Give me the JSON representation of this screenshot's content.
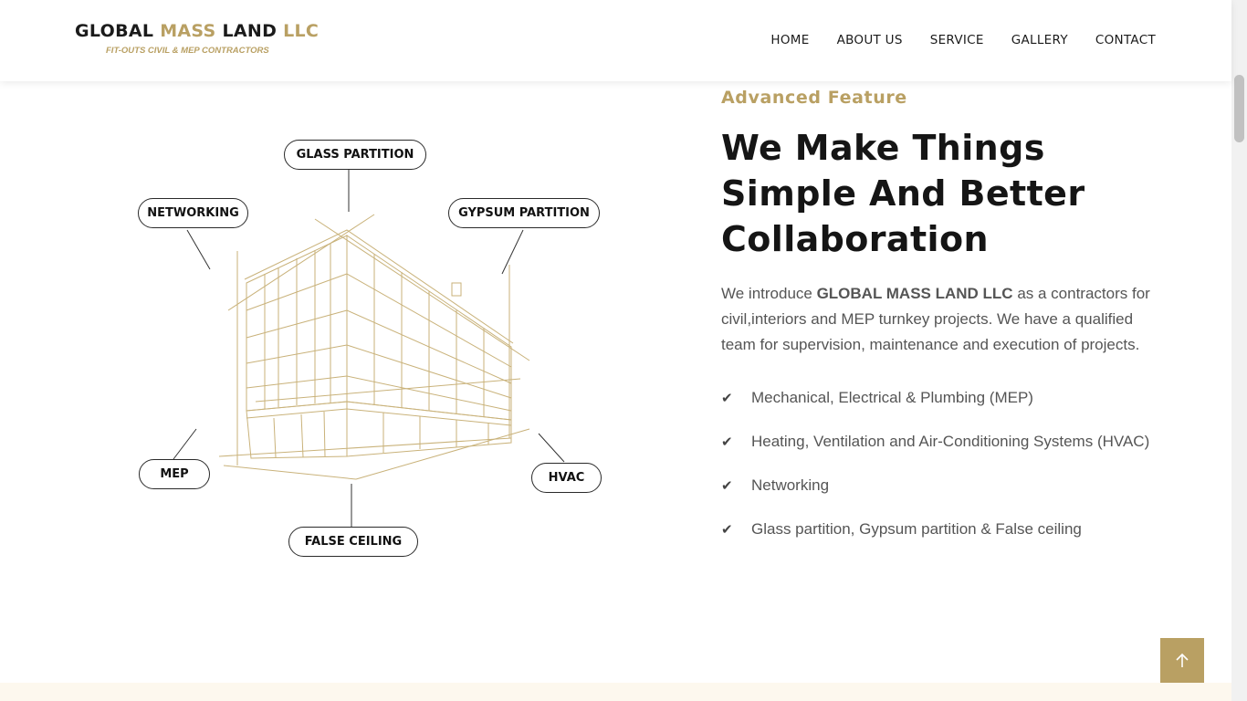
{
  "brand": {
    "name_part1": "GLOBAL",
    "name_part2": "MASS",
    "name_part3": "LAND",
    "name_part4": "LLC",
    "tagline": "FIT-OUTS CIVIL & MEP CONTRACTORS"
  },
  "nav": {
    "items": [
      "HOME",
      "ABOUT US",
      "SERVICE",
      "GALLERY",
      "CONTACT"
    ]
  },
  "illustration": {
    "labels": {
      "glass_partition": "GLASS PARTITION",
      "networking": "NETWORKING",
      "gypsum_partition": "GYPSUM PARTITION",
      "mep": "MEP",
      "hvac": "HVAC",
      "false_ceiling": "FALSE CEILING"
    },
    "line_color": "#c9b27a"
  },
  "content": {
    "eyebrow": "Advanced Feature",
    "heading": "We Make Things Simple And Better Collaboration",
    "intro_before": "We introduce ",
    "intro_bold": "GLOBAL MASS LAND LLC",
    "intro_after": " as a contractors for civil,interiors and MEP turnkey projects. We have a qualified team for supervision, maintenance and execution of projects.",
    "features": [
      "Mechanical, Electrical & Plumbing (MEP)",
      "Heating, Ventilation and Air-Conditioning Systems (HVAC)",
      "Networking",
      "Glass partition, Gypsum partition & False ceiling"
    ],
    "check_icon": "check-icon"
  },
  "colors": {
    "accent": "#b9a063",
    "text": "#555555",
    "heading": "#151515"
  },
  "back_to_top_icon": "arrow-up-icon"
}
